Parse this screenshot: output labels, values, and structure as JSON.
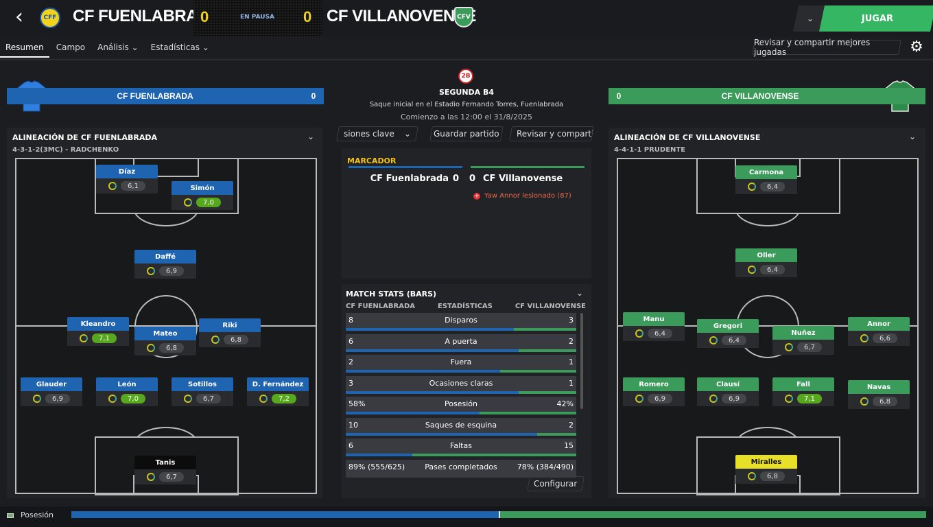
{
  "header": {
    "home_name": "CF FUENLABRADA",
    "away_name": "CF VILLANOVENSE",
    "home_score": "0",
    "away_score": "0",
    "status": "EN PAUSA",
    "play_label": "JUGAR",
    "home_crest": "CFF",
    "away_crest": "CFV"
  },
  "tabs": [
    {
      "label": "Resumen"
    },
    {
      "label": "Campo"
    },
    {
      "label": "Análisis ⌄"
    },
    {
      "label": "Estadísticas ⌄"
    }
  ],
  "share_label": "Revisar y compartir mejores jugadas",
  "center": {
    "comp_badge": "2B",
    "comp_name": "SEGUNDA B4",
    "venue": "Saque inicial en el Estadio Fernando Torres, Fuenlabrada",
    "kickoff": "Comienzo a las 12:00 el 31/8/2025",
    "btn1": "siones clave",
    "btn2": "Guardar partido",
    "btn3": "Revisar y compartir r"
  },
  "scorer": {
    "title": "MARCADOR",
    "home": "CF Fuenlabrada",
    "home_goals": "0",
    "away_goals": "0",
    "away": "CF Villanovense",
    "event": "Yaw Annor lesionado (87)"
  },
  "home": {
    "bar_name": "CF FUENLABRADA",
    "bar_score": "0",
    "lineup_title": "ALINEACIÓN DE CF FUENLABRADA",
    "formation": "4-3-1-2(3MC) - RADCHENKO",
    "players": [
      {
        "name": "Díaz",
        "rating": "6,1",
        "good": false
      },
      {
        "name": "Simón",
        "rating": "7,0",
        "good": true
      },
      {
        "name": "Daffé",
        "rating": "6,9",
        "good": false
      },
      {
        "name": "Kleandro",
        "rating": "7,1",
        "good": true
      },
      {
        "name": "Mateo",
        "rating": "6,8",
        "good": false
      },
      {
        "name": "Riki",
        "rating": "6,8",
        "good": false
      },
      {
        "name": "Glauder",
        "rating": "6,9",
        "good": false
      },
      {
        "name": "León",
        "rating": "7,0",
        "good": true
      },
      {
        "name": "Sotillos",
        "rating": "6,7",
        "good": false
      },
      {
        "name": "D. Fernández",
        "rating": "7,2",
        "good": true
      },
      {
        "name": "Tanis",
        "rating": "6,7",
        "good": false
      }
    ]
  },
  "away": {
    "bar_name": "CF VILLANOVENSE",
    "bar_score": "0",
    "lineup_title": "ALINEACIÓN DE CF VILLANOVENSE",
    "formation": "4-4-1-1 PRUDENTE",
    "players": [
      {
        "name": "Carmona",
        "rating": "6,4",
        "good": false
      },
      {
        "name": "Oller",
        "rating": "6,4",
        "good": false
      },
      {
        "name": "Manu",
        "rating": "6,4",
        "good": false
      },
      {
        "name": "Gregori",
        "rating": "6,4",
        "good": false
      },
      {
        "name": "Nuñez",
        "rating": "6,7",
        "good": false
      },
      {
        "name": "Annor",
        "rating": "6,6",
        "good": false
      },
      {
        "name": "Romero",
        "rating": "6,9",
        "good": false
      },
      {
        "name": "Clausí",
        "rating": "6,9",
        "good": false
      },
      {
        "name": "Fall",
        "rating": "7,1",
        "good": true
      },
      {
        "name": "Navas",
        "rating": "6,8",
        "good": false
      },
      {
        "name": "Miralles",
        "rating": "6,8",
        "good": false
      }
    ]
  },
  "stats": {
    "title": "MATCH STATS (BARS)",
    "col_home": "CF FUENLABRADA",
    "col_mid": "ESTADÍSTICAS",
    "col_away": "CF VILLANOVENSE",
    "configure": "Configurar",
    "rows": [
      {
        "home": "8",
        "label": "Disparos",
        "away": "3",
        "home_share": 0.73
      },
      {
        "home": "6",
        "label": "A puerta",
        "away": "2",
        "home_share": 0.75
      },
      {
        "home": "2",
        "label": "Fuera",
        "away": "1",
        "home_share": 0.67
      },
      {
        "home": "3",
        "label": "Ocasiones claras",
        "away": "1",
        "home_share": 0.75
      },
      {
        "home": "58%",
        "label": "Posesión",
        "away": "42%",
        "home_share": 0.58
      },
      {
        "home": "10",
        "label": "Saques de esquina",
        "away": "2",
        "home_share": 0.83
      },
      {
        "home": "6",
        "label": "Faltas",
        "away": "15",
        "home_share": 0.29
      },
      {
        "home": "89% (555/625)",
        "label": "Pases completados",
        "away": "78% (384/490)",
        "home_share": 0.5
      }
    ]
  },
  "bottom": {
    "label": "Posesión",
    "home_share": 0.5
  },
  "colors": {
    "home": "#1e64b0",
    "away": "#3a9b5a",
    "play": "#35b662"
  }
}
